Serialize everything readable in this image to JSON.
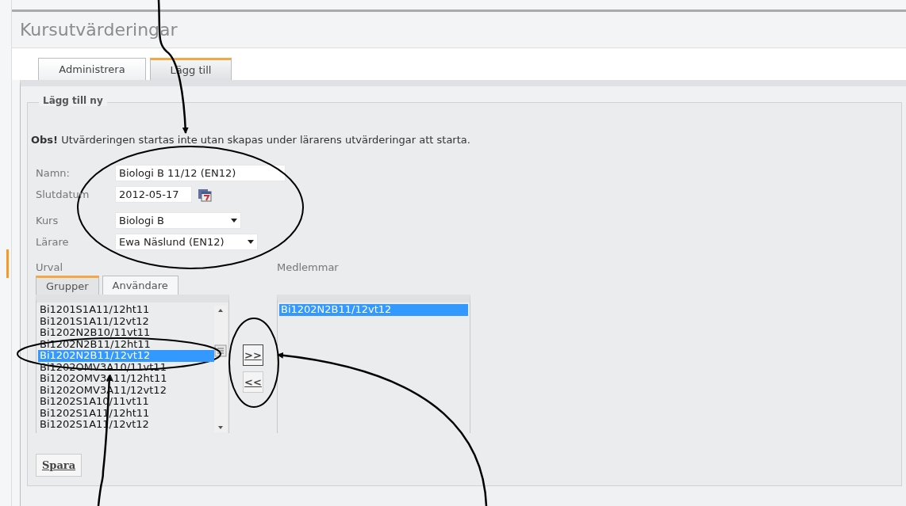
{
  "page": {
    "title": "Kursutvärderingar"
  },
  "tabs": [
    {
      "label": "Administrera",
      "selected": false
    },
    {
      "label": "Lägg till",
      "selected": true
    }
  ],
  "fieldset": {
    "legend": "Lägg till ny"
  },
  "notice": "**Obs!** Utvärderingen startas inte utan skapas under lärarens utvärderingar att starta.",
  "form_fields": [
    {
      "kind": "text",
      "label": "Namn:",
      "value": "Biologi B 11/12 (EN12)"
    },
    {
      "kind": "date",
      "label": "Slutdatum",
      "value": "2012-05-17"
    },
    {
      "kind": "select",
      "label": "Kurs",
      "value": "Biologi B"
    },
    {
      "kind": "select",
      "label": "Lärare",
      "value": "Ewa Näslund (EN12)"
    }
  ],
  "selection": {
    "label": "Urval",
    "tabs": [
      {
        "label": "Grupper",
        "selected": true
      },
      {
        "label": "Användare",
        "selected": false
      }
    ],
    "items": [
      {
        "label": "Bi1201S1A11/12ht11",
        "selected": false
      },
      {
        "label": "Bi1201S1A11/12vt12",
        "selected": false
      },
      {
        "label": "Bi1202N2B10/11vt11",
        "selected": false
      },
      {
        "label": "Bi1202N2B11/12ht11",
        "selected": false
      },
      {
        "label": "Bi1202N2B11/12vt12",
        "selected": true
      },
      {
        "label": "Bi1202OMV3A10/11vt11",
        "selected": false
      },
      {
        "label": "Bi1202OMV3A11/12ht11",
        "selected": false
      },
      {
        "label": "Bi1202OMV3A11/12vt12",
        "selected": false
      },
      {
        "label": "Bi1202S1A10/11vt11",
        "selected": false
      },
      {
        "label": "Bi1202S1A11/12ht11",
        "selected": false
      },
      {
        "label": "Bi1202S1A11/12vt12",
        "selected": false
      }
    ]
  },
  "transfer_buttons": [
    {
      "label": ">>",
      "selected": true
    },
    {
      "label": "<<",
      "selected": false
    }
  ],
  "members": {
    "label": "Medlemmar",
    "items": [
      {
        "label": "Bi1202N2B11/12vt12",
        "selected": true
      }
    ]
  },
  "save_button": "Spara"
}
